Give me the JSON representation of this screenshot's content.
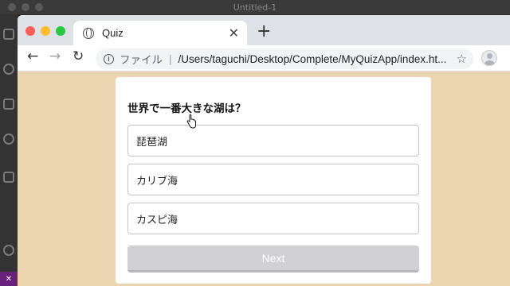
{
  "editor": {
    "window_title": "Untitled-1"
  },
  "browser": {
    "tab": {
      "title": "Quiz",
      "close_glyph": "✕",
      "icon": "globe-icon"
    },
    "new_tab_glyph": "+",
    "nav": {
      "back_glyph": "←",
      "forward_glyph": "→",
      "reload_glyph": "↻"
    },
    "address_bar": {
      "scheme_label": "ファイル",
      "separator": "|",
      "url": "/Users/taguchi/Desktop/Complete/MyQuizApp/index.ht...",
      "bookmark_glyph": "☆"
    }
  },
  "quiz": {
    "question": "世界で一番大きな湖は？",
    "choices": [
      {
        "label": "琵琶湖"
      },
      {
        "label": "カリブ海"
      },
      {
        "label": "カスピ海"
      }
    ],
    "next_label": "Next"
  },
  "colors": {
    "page_background": "#ecd6b1",
    "next_disabled": "#d1d0d4",
    "traffic_red": "#ff5f57",
    "traffic_yellow": "#febc2e",
    "traffic_green": "#28c840"
  }
}
